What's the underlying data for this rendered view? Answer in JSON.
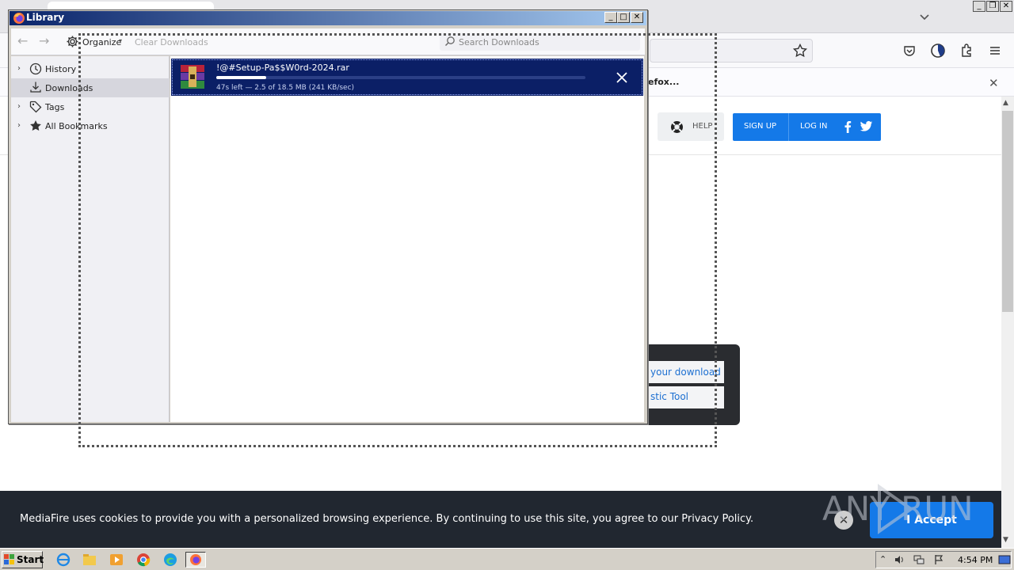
{
  "browser": {
    "notification_text": "efox...",
    "site_nav": {
      "help_label": "HELP",
      "signup_label": "SIGN UP",
      "login_label": "LOG IN"
    },
    "panel_links": [
      "your download",
      "stic Tool"
    ],
    "cookie_banner": {
      "text": "MediaFire uses cookies to provide you with a personalized browsing experience. By continuing to use this site, you agree to our Privacy Policy.",
      "accept_label": "I Accept"
    },
    "watermark": "ANY RUN"
  },
  "library": {
    "title": "Library",
    "toolbar": {
      "organize_label": "Organize",
      "clear_label": "Clear Downloads",
      "search_placeholder": "Search Downloads"
    },
    "sidebar": [
      {
        "label": "History",
        "icon": "clock-icon",
        "expandable": true,
        "selected": false
      },
      {
        "label": "Downloads",
        "icon": "download-icon",
        "expandable": false,
        "selected": true
      },
      {
        "label": "Tags",
        "icon": "tag-icon",
        "expandable": true,
        "selected": false
      },
      {
        "label": "All Bookmarks",
        "icon": "star-icon",
        "expandable": true,
        "selected": false
      }
    ],
    "download": {
      "filename": "!@#Setup-Pa$$W0rd-2024.rar",
      "status": "47s left — 2.5 of 18.5 MB (241 KB/sec)",
      "progress": 0.135
    }
  },
  "taskbar": {
    "start_label": "Start",
    "apps": [
      "ie-icon",
      "explorer-icon",
      "media-player-icon",
      "chrome-icon",
      "edge-icon",
      "firefox-icon"
    ],
    "clock": "4:54 PM"
  },
  "colors": {
    "accent_blue": "#1479e8",
    "selection_navy": "#0b1f66",
    "cookie_bg": "#212730"
  }
}
